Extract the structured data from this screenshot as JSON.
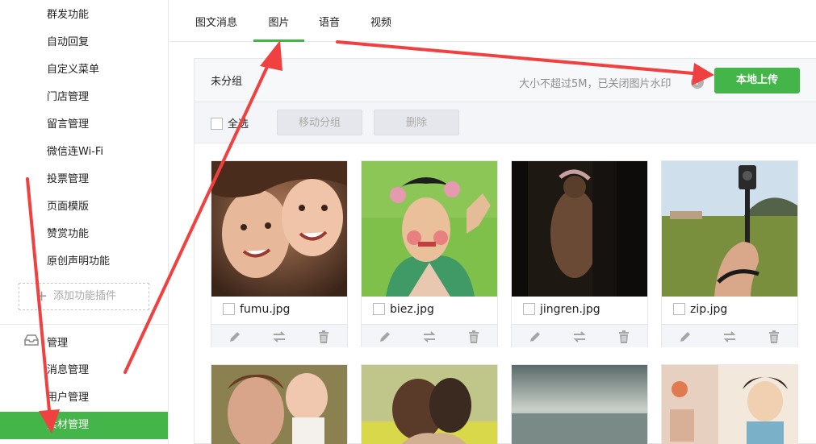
{
  "sidebar": {
    "items": [
      {
        "label": "群发功能"
      },
      {
        "label": "自动回复"
      },
      {
        "label": "自定义菜单"
      },
      {
        "label": "门店管理"
      },
      {
        "label": "留言管理"
      },
      {
        "label": "微信连Wi-Fi"
      },
      {
        "label": "投票管理"
      },
      {
        "label": "页面模版"
      },
      {
        "label": "赞赏功能"
      },
      {
        "label": "原创声明功能"
      }
    ],
    "add_plugin_label": "添加功能插件",
    "section_title": "管理",
    "manage_items": [
      {
        "label": "消息管理"
      },
      {
        "label": "用户管理"
      },
      {
        "label": "素材管理",
        "active": true
      }
    ]
  },
  "tabs": [
    {
      "label": "图文消息"
    },
    {
      "label": "图片",
      "active": true
    },
    {
      "label": "语音"
    },
    {
      "label": "视频"
    }
  ],
  "panel": {
    "group_name": "未分组",
    "hint": "大小不超过5M，已关闭图片水印",
    "help_icon": "?",
    "upload_label": "本地上传",
    "select_all_label": "全选",
    "move_group_label": "移动分组",
    "delete_label": "删除"
  },
  "images": [
    {
      "name": "fumu.jpg"
    },
    {
      "name": "biez.jpg"
    },
    {
      "name": "jingren.jpg"
    },
    {
      "name": "zip.jpg"
    }
  ],
  "colors": {
    "accent": "#44b549",
    "annotation_arrow": "#f04040"
  }
}
